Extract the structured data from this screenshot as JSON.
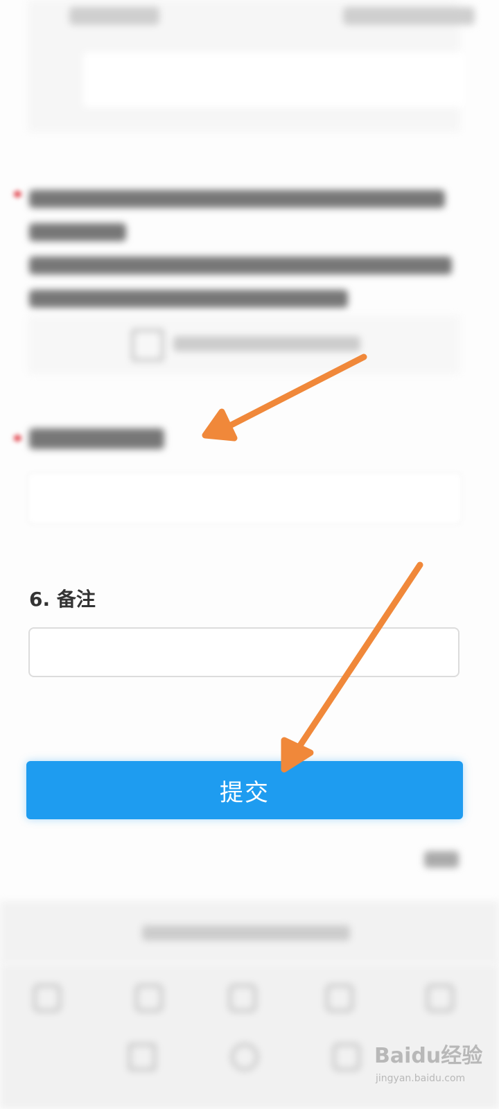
{
  "form": {
    "question6": {
      "title": "6. 备注",
      "value": ""
    },
    "submit_label": "提交"
  },
  "colors": {
    "submit_button": "#1e9cf0",
    "arrow": "#f0883a",
    "required_star": "#e0424b"
  },
  "icons": {
    "upload": "upload-icon",
    "back": "back-icon",
    "forward": "forward-icon",
    "home": "home-icon",
    "tabs": "tabs-icon",
    "menu": "menu-icon"
  },
  "watermark": {
    "brand": "Baidu经验",
    "url": "jingyan.baidu.com"
  }
}
